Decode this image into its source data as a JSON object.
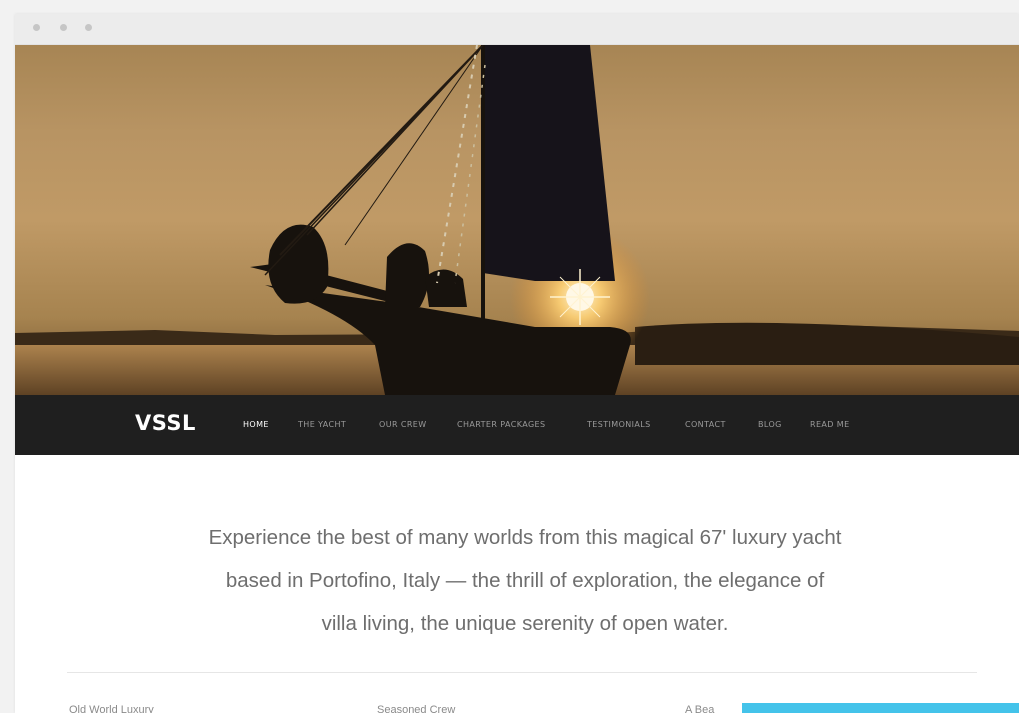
{
  "site": {
    "logo": "VSSL",
    "nav": [
      "HOME",
      "THE YACHT",
      "OUR CREW",
      "CHARTER PACKAGES",
      "TESTIMONIALS",
      "CONTACT",
      "BLOG",
      "READ ME"
    ],
    "active_nav": "HOME"
  },
  "intro": {
    "line1": "Experience the best of many worlds from this magical 67' luxury yacht",
    "line2": "based in Portofino, Italy — the thrill of exploration, the elegance of",
    "line3": "villa living, the unique serenity of open water."
  },
  "features": [
    "Old World Luxury",
    "Seasoned Crew",
    "A Bea"
  ],
  "colors": {
    "navbar": "#1f1f1f",
    "hero_sky": "#b89463",
    "accent": "#44c3ea",
    "text": "#6e6e6e"
  }
}
